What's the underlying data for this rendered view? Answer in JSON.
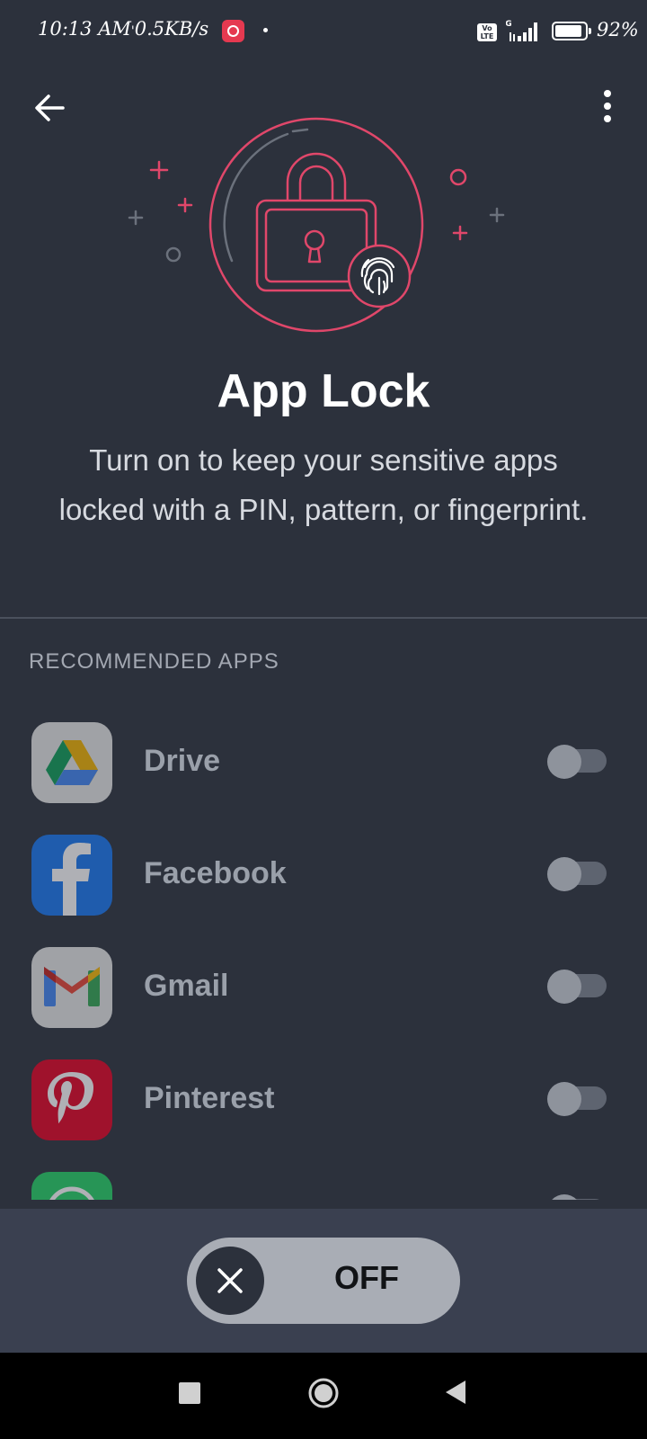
{
  "status_bar": {
    "time": "10:13 AM",
    "speed": "0.5KB/s",
    "network": "4G",
    "volte": "Vo LTE",
    "battery_level": 0.92,
    "battery_text": "92%"
  },
  "header": {
    "back_icon": "arrow-left-icon",
    "menu_icon": "more-vertical-icon"
  },
  "hero": {
    "illustration": "lock-fingerprint-illustration",
    "accent_color": "#e0476a"
  },
  "title": "App Lock",
  "description": "Turn on to keep your sensitive apps locked with a PIN, pattern, or fingerprint.",
  "section_label": "RECOMMENDED APPS",
  "apps": [
    {
      "name": "Drive",
      "icon": "google-drive-icon",
      "enabled": false
    },
    {
      "name": "Facebook",
      "icon": "facebook-icon",
      "enabled": false
    },
    {
      "name": "Gmail",
      "icon": "gmail-icon",
      "enabled": false
    },
    {
      "name": "Pinterest",
      "icon": "pinterest-icon",
      "enabled": false
    }
  ],
  "master_switch": {
    "label": "OFF",
    "icon": "close-icon",
    "enabled": false
  },
  "colors": {
    "background": "#2c313c",
    "bottom_panel": "#3a4050",
    "accent": "#e0476a"
  }
}
